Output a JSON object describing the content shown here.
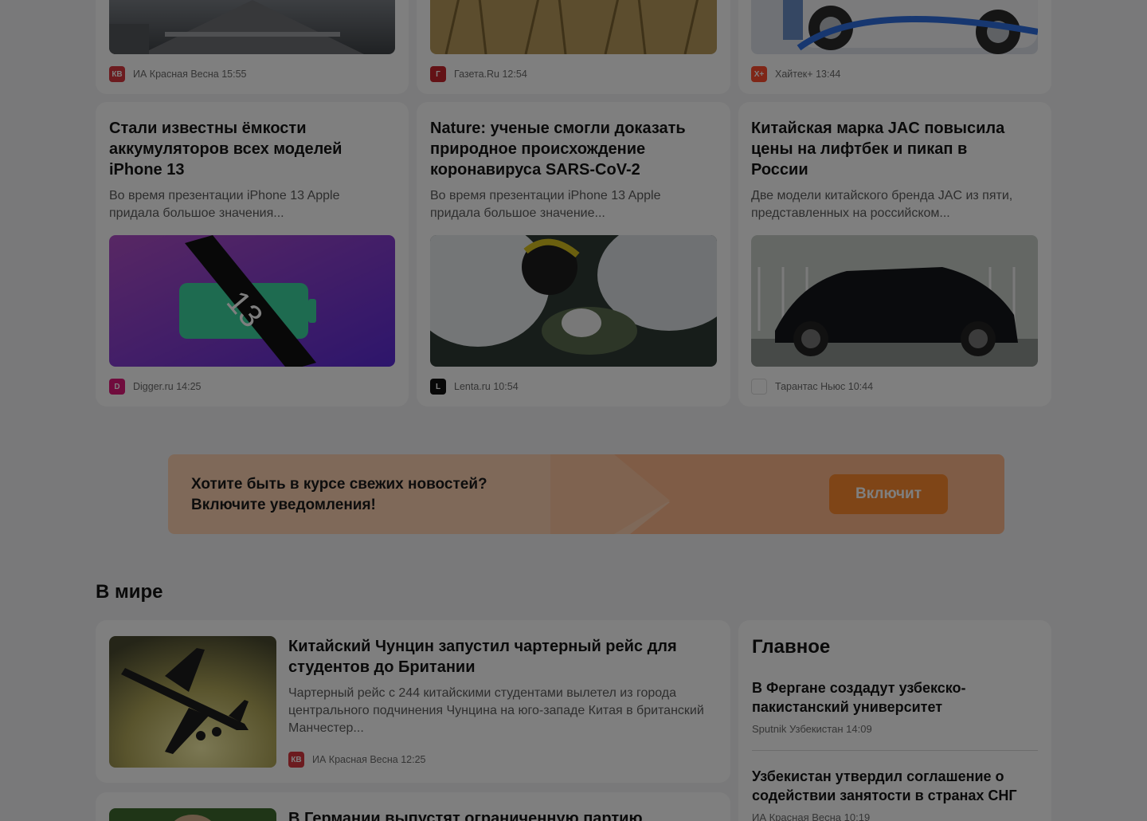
{
  "top_sources": [
    {
      "source": "ИА Красная Весна",
      "time": "15:55",
      "logo_text": "КВ",
      "logo_color": "#d9363e"
    },
    {
      "source": "Газета.Ru",
      "time": "12:54",
      "logo_text": "Г",
      "logo_color": "#c7242c"
    },
    {
      "source": "Хайтек+",
      "time": "13:44",
      "logo_text": "Х+",
      "logo_color": "#ff4d2e"
    }
  ],
  "cards": [
    {
      "title": "Стали известны ёмкости аккумуляторов всех моделей iPhone 13",
      "desc": "Во время презентации iPhone 13 Apple придала большое значения...",
      "source": "Digger.ru",
      "time": "14:25",
      "logo_text": "D",
      "logo_color": "#e0187a"
    },
    {
      "title": "Nature: ученые смогли доказать природное происхождение коронавируса SARS-CoV-2",
      "desc": "Во время презентации iPhone 13 Apple придала большое значение...",
      "source": "Lenta.ru",
      "time": "10:54",
      "logo_text": "L",
      "logo_color": "#111111"
    },
    {
      "title": "Китайская марка JAC повысила цены на лифтбек и пикап в России",
      "desc": "Две модели китайского бренда JAC из пяти, представленных на российском...",
      "source": "Тарантас Ньюс",
      "time": "10:44",
      "logo_text": "",
      "logo_color": "#ffffff"
    }
  ],
  "banner": {
    "line1": "Хотите быть в курсе свежих новостей?",
    "line2": "Включите уведомления!",
    "button": "Включит"
  },
  "world": {
    "section_title": "В мире",
    "items": [
      {
        "title": "Китайский Чунцин запустил чартерный рейс для студентов до Британии",
        "desc": "Чартерный рейс с 244 китайскими студентами вылетел из города центрального подчинения Чунцина на юго-западе Китая в британский Манчестер...",
        "source": "ИА Красная Весна",
        "time": "12:25",
        "logo_text": "КВ",
        "logo_color": "#d9363e"
      },
      {
        "title": "В Германии выпустят ограниченную партию"
      }
    ]
  },
  "main_panel": {
    "title": "Главное",
    "items": [
      {
        "title": "В Фергане создадут узбекско-пакистанский университет",
        "source": "Sputnik Узбекистан",
        "time": "14:09"
      },
      {
        "title": "Узбекистан утвердил соглашение о содействии занятости в странах СНГ",
        "source": "ИА Красная Весна",
        "time": "10:19"
      }
    ]
  }
}
